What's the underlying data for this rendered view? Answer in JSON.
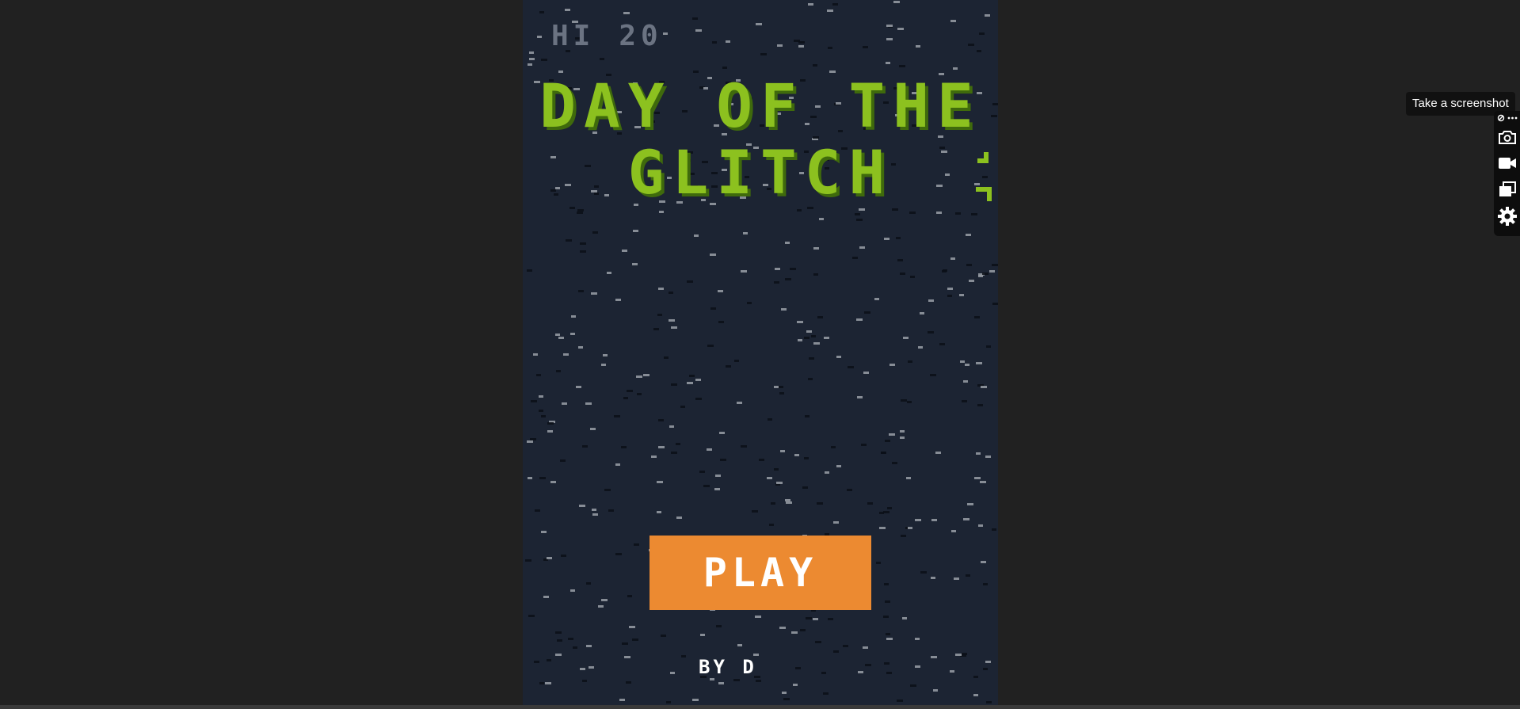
{
  "game": {
    "hi_label": "HI",
    "hi_score": "20",
    "title_line1": "DAY OF THE",
    "title_line2": "GLITCH",
    "play_label": "PLAY",
    "byline": "BY D"
  },
  "overlay": {
    "tooltip": "Take a screenshot",
    "toolbar_top_icons": [
      "link-icon",
      "more-icon"
    ],
    "toolbar_buttons": [
      "camera-icon",
      "video-icon",
      "copy-icon",
      "gear-icon"
    ]
  },
  "colors": {
    "background": "#212121",
    "game_background": "#1c2433",
    "title_green": "#8cc11f",
    "title_shadow": "#3f6a0c",
    "play_orange": "#ec8a31",
    "hi_gray": "#6b7382",
    "star_light": "#9aa0a8",
    "star_dark": "#0b0f17"
  }
}
